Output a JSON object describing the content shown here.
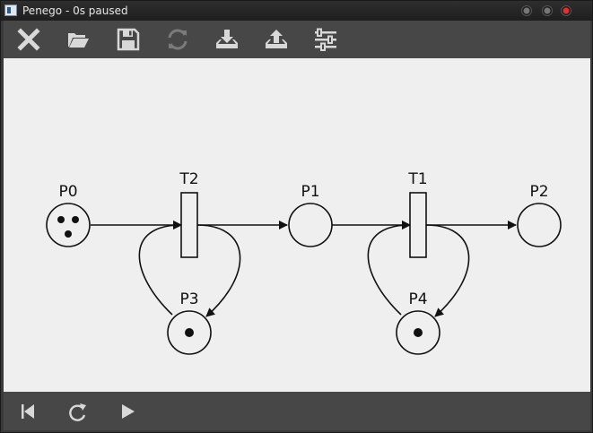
{
  "window": {
    "title": "Penego - 0s paused"
  },
  "toolbar": {
    "buttons": [
      {
        "name": "close-net-button",
        "icon": "close-icon"
      },
      {
        "name": "open-button",
        "icon": "folder-open-icon"
      },
      {
        "name": "save-button",
        "icon": "save-icon"
      },
      {
        "name": "reload-button",
        "icon": "refresh-icon",
        "disabled": true
      },
      {
        "name": "import-button",
        "icon": "tray-download-icon"
      },
      {
        "name": "export-button",
        "icon": "tray-upload-icon"
      },
      {
        "name": "settings-button",
        "icon": "sliders-icon"
      }
    ]
  },
  "net": {
    "places": [
      {
        "id": "P0",
        "label": "P0",
        "tokens": 3
      },
      {
        "id": "P1",
        "label": "P1",
        "tokens": 0
      },
      {
        "id": "P2",
        "label": "P2",
        "tokens": 0
      },
      {
        "id": "P3",
        "label": "P3",
        "tokens": 1
      },
      {
        "id": "P4",
        "label": "P4",
        "tokens": 1
      }
    ],
    "transitions": [
      {
        "id": "T2",
        "label": "T2"
      },
      {
        "id": "T1",
        "label": "T1"
      }
    ],
    "arcs": [
      {
        "from": "P0",
        "to": "T2"
      },
      {
        "from": "T2",
        "to": "P1"
      },
      {
        "from": "T2",
        "to": "P3"
      },
      {
        "from": "P3",
        "to": "T2"
      },
      {
        "from": "P1",
        "to": "T1"
      },
      {
        "from": "T1",
        "to": "P2"
      },
      {
        "from": "T1",
        "to": "P4"
      },
      {
        "from": "P4",
        "to": "T1"
      }
    ]
  },
  "controls": {
    "buttons": [
      {
        "name": "reset-button",
        "icon": "skip-back-icon"
      },
      {
        "name": "step-button",
        "icon": "redo-icon"
      },
      {
        "name": "play-button",
        "icon": "play-icon"
      }
    ]
  },
  "colors": {
    "toolbar_bg": "#474747",
    "canvas_bg": "#efefef",
    "icon": "#d8d8d8",
    "icon_disabled": "#7a7a7a",
    "ink": "#111111"
  }
}
